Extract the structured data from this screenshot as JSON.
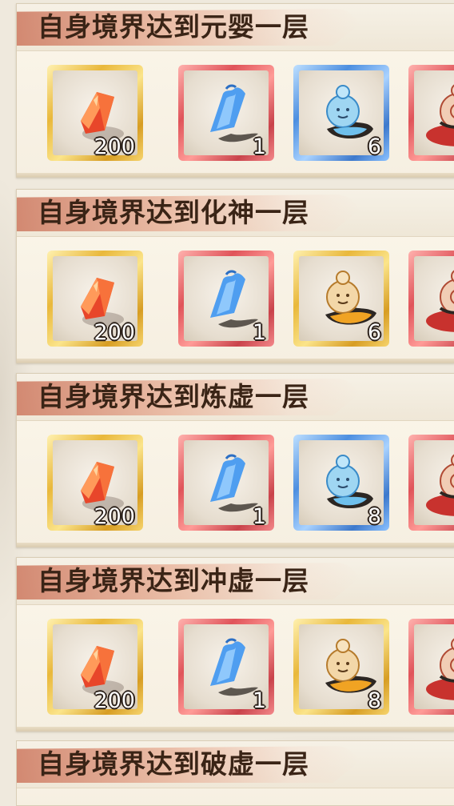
{
  "rows": [
    {
      "title": "自身境界达到元婴一层",
      "items": [
        {
          "name": "red-crystal",
          "frame": "gold",
          "icon": "red-crystal-icon",
          "count": "200"
        },
        {
          "name": "blue-talisman",
          "frame": "red",
          "icon": "blue-talisman-icon",
          "count": "1"
        },
        {
          "name": "blue-gourd",
          "frame": "blue",
          "icon": "blue-gourd-spirit-icon",
          "count": "6"
        },
        {
          "name": "red-pouch",
          "frame": "red",
          "icon": "red-pouch-icon",
          "count": ""
        }
      ]
    },
    {
      "title": "自身境界达到化神一层",
      "items": [
        {
          "name": "red-crystal",
          "frame": "gold",
          "icon": "red-crystal-icon",
          "count": "200"
        },
        {
          "name": "blue-talisman",
          "frame": "red",
          "icon": "blue-talisman-icon",
          "count": "1"
        },
        {
          "name": "gold-gourd",
          "frame": "gold",
          "icon": "gold-gourd-spirit-icon",
          "count": "6"
        },
        {
          "name": "red-pouch",
          "frame": "red",
          "icon": "red-pouch-icon",
          "count": ""
        }
      ]
    },
    {
      "title": "自身境界达到炼虚一层",
      "items": [
        {
          "name": "red-crystal",
          "frame": "gold",
          "icon": "red-crystal-icon",
          "count": "200"
        },
        {
          "name": "blue-talisman",
          "frame": "red",
          "icon": "blue-talisman-icon",
          "count": "1"
        },
        {
          "name": "blue-gourd",
          "frame": "blue",
          "icon": "blue-gourd-spirit-icon",
          "count": "8"
        },
        {
          "name": "red-pouch",
          "frame": "red",
          "icon": "red-pouch-icon",
          "count": ""
        }
      ]
    },
    {
      "title": "自身境界达到冲虚一层",
      "items": [
        {
          "name": "red-crystal",
          "frame": "gold",
          "icon": "red-crystal-icon",
          "count": "200"
        },
        {
          "name": "blue-talisman",
          "frame": "red",
          "icon": "blue-talisman-icon",
          "count": "1"
        },
        {
          "name": "gold-gourd",
          "frame": "gold",
          "icon": "gold-gourd-spirit-icon",
          "count": "8"
        },
        {
          "name": "red-pouch",
          "frame": "red",
          "icon": "red-pouch-icon",
          "count": ""
        }
      ]
    }
  ],
  "last_row": {
    "title": "自身境界达到破虚一层"
  },
  "colors": {
    "gold_frame": "#e9b83b",
    "red_frame": "#e0545a",
    "blue_frame": "#4d8fe0",
    "title_text": "#3a2416",
    "banner_accent": "#cd785f",
    "card_bg": "#fbf6ea"
  }
}
